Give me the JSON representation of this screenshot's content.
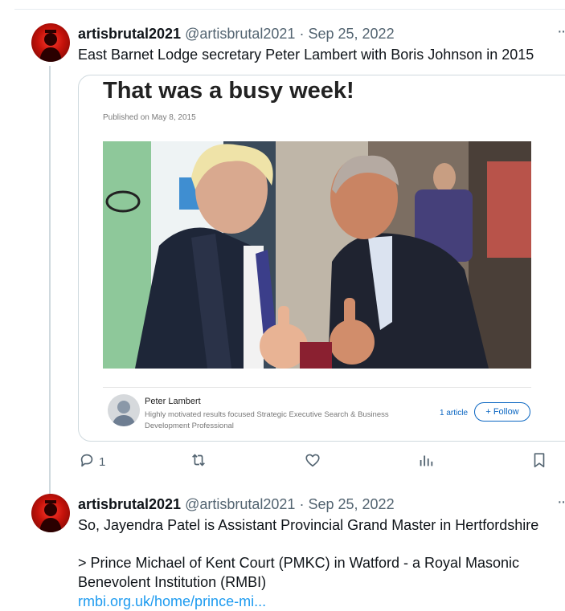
{
  "tweets": [
    {
      "display_name": "artisbrutal2021",
      "handle": "@artisbrutal2021",
      "separator": "·",
      "date": "Sep 25, 2022",
      "text": "East Barnet Lodge secretary Peter Lambert with Boris Johnson in 2015",
      "replies_count": "1"
    },
    {
      "display_name": "artisbrutal2021",
      "handle": "@artisbrutal2021",
      "separator": "·",
      "date": "Sep 25, 2022",
      "text_line1": "So, Jayendra Patel is Assistant Provincial Grand Master in Hertfordshire",
      "text_line2": "> Prince Michael of Kent Court (PMKC) in Watford - a Royal Masonic",
      "text_line3": "Benevolent Institution (RMBI)",
      "link": "rmbi.org.uk/home/prince-mi..."
    }
  ],
  "card": {
    "title": "That was a busy week!",
    "published": "Published on May 8, 2015",
    "author_name": "Peter Lambert",
    "author_bio": "Highly motivated results focused Strategic Executive Search & Business Development Professional",
    "article_count": "1 article",
    "follow_label": "+ Follow"
  },
  "icons": {
    "reply": "reply-icon",
    "retweet": "retweet-icon",
    "like": "heart-icon",
    "views": "views-icon",
    "bookmark": "bookmark-icon",
    "more": "more-icon"
  },
  "colors": {
    "link": "#1d9bf0",
    "muted": "#536471",
    "linkedin_blue": "#0a66c2",
    "avatar_red": "#d0140c"
  }
}
